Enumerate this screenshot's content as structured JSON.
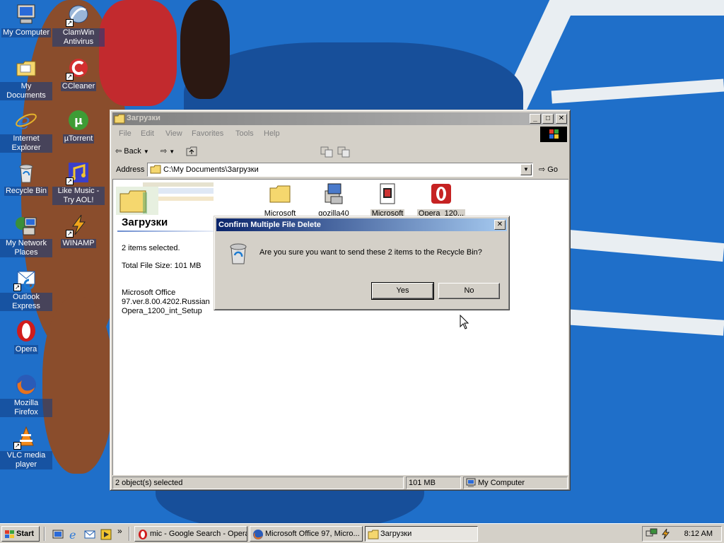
{
  "desktop": {
    "icons": [
      {
        "label": "My Computer"
      },
      {
        "label": "ClamWin Antivirus"
      },
      {
        "label": "My Documents"
      },
      {
        "label": "CCleaner"
      },
      {
        "label": "Internet Explorer"
      },
      {
        "label": "µTorrent"
      },
      {
        "label": "Recycle Bin"
      },
      {
        "label": "Like Music - Try AOL!"
      },
      {
        "label": "My Network Places"
      },
      {
        "label": "WINAMP"
      },
      {
        "label": "Outlook Express"
      },
      {
        "label": "Opera"
      },
      {
        "label": "Mozilla Firefox"
      },
      {
        "label": "VLC media player"
      }
    ]
  },
  "explorer": {
    "title": "Загрузки",
    "menu": [
      "File",
      "Edit",
      "View",
      "Favorites",
      "Tools",
      "Help"
    ],
    "toolbar": {
      "back": "Back"
    },
    "address": {
      "label": "Address",
      "value": "C:\\My Documents\\Загрузки",
      "go": "Go"
    },
    "folder_title": "Загрузки",
    "info": {
      "selected": "2 items selected.",
      "size": "Total File Size: 101 MB",
      "file1_line1": "Microsoft Office",
      "file1_line2": "97.ver.8.00.4202.Russian",
      "file2": "Opera_1200_int_Setup"
    },
    "files": [
      {
        "name": "Microsoft",
        "icon": "folder-icon",
        "selected": false
      },
      {
        "name": "gozilla40",
        "icon": "installer-icon",
        "selected": false
      },
      {
        "name": "Microsoft",
        "icon": "setup-file-icon",
        "selected": true
      },
      {
        "name": "Opera_120...",
        "icon": "opera-installer-icon",
        "selected": true
      }
    ],
    "status": {
      "objects": "2 object(s) selected",
      "size": "101 MB",
      "zone": "My Computer"
    }
  },
  "dialog": {
    "title": "Confirm Multiple File Delete",
    "message": "Are you sure you want to send these 2 items to the Recycle Bin?",
    "yes": "Yes",
    "no": "No"
  },
  "taskbar": {
    "start": "Start",
    "quick_launch_more": "»",
    "tasks": [
      {
        "label": "mic - Google Search - Opera",
        "icon": "opera-icon"
      },
      {
        "label": "Microsoft Office 97, Micro...",
        "icon": "firefox-icon"
      },
      {
        "label": "Загрузки",
        "icon": "folder-icon",
        "active": true
      }
    ],
    "clock": "8:12 AM"
  },
  "colors": {
    "desktop_blue": "#1f6fc9",
    "window_gray": "#d4d0c8",
    "active_title": "#0a246a",
    "inactive_title": "#808080"
  }
}
